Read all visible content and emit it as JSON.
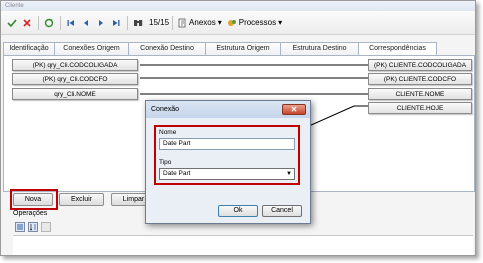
{
  "window": {
    "title": "Cliente"
  },
  "toolbar": {
    "record_counter": "15/15",
    "anexos_label": "Anexos",
    "processos_label": "Processos"
  },
  "tabs": [
    {
      "label": "Identificação"
    },
    {
      "label": "Conexões Origem"
    },
    {
      "label": "Conexão Destino"
    },
    {
      "label": "Estrutura Origem"
    },
    {
      "label": "Estrutura Destino"
    },
    {
      "label": "Correspondências"
    }
  ],
  "fields_left": [
    {
      "label": "(PK) qry_Cli.CODCOLIGADA"
    },
    {
      "label": "(PK) qry_Cli.CODCFO"
    },
    {
      "label": "qry_Cli.NOME"
    }
  ],
  "fields_right": [
    {
      "label": "(PK) CLIENTE.CODCOLIGADA"
    },
    {
      "label": "(PK) CLIENTE.CODCFO"
    },
    {
      "label": "CLIENTE.NOME"
    },
    {
      "label": "CLIENTE.HOJE"
    }
  ],
  "buttons": {
    "nova": "Nova",
    "excluir": "Excluir",
    "limpar": "Limpar"
  },
  "operations": {
    "label": "Operações"
  },
  "dialog": {
    "title": "Conexão",
    "nome_label": "Nome",
    "nome_value": "Date Part",
    "tipo_label": "Tipo",
    "tipo_value": "Date Part",
    "ok_label": "Ok",
    "cancel_label": "Cancel"
  },
  "colors": {
    "highlight": "#c00000",
    "accent": "#3c7fb1"
  }
}
